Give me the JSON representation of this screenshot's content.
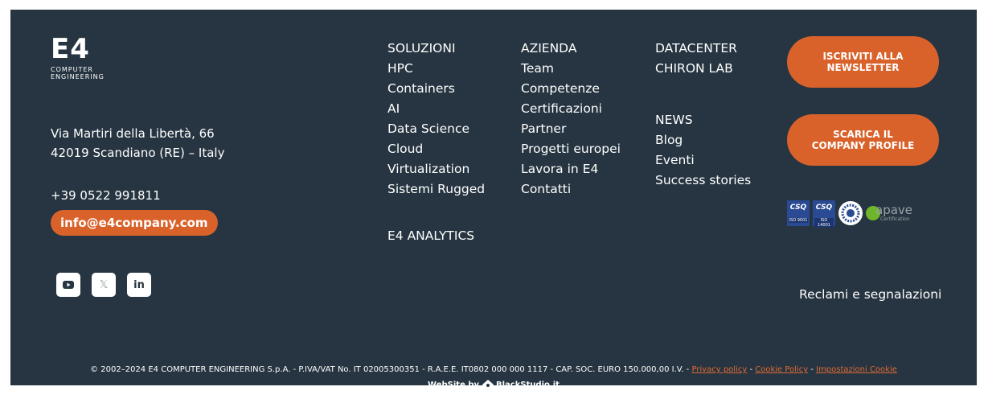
{
  "logo": {
    "main": "E4",
    "line1": "COMPUTER",
    "line2": "ENGINEERING"
  },
  "contact": {
    "address_line1": "Via Martiri della Libertà, 66",
    "address_line2": "42019 Scandiano (RE) – Italy",
    "phone": "+39 0522 991811",
    "email": "info@e4company.com"
  },
  "social": [
    {
      "icon": "youtube-icon",
      "glyph": "▶"
    },
    {
      "icon": "x-icon",
      "glyph": "𝕏"
    },
    {
      "icon": "linkedin-icon",
      "glyph": "in"
    }
  ],
  "col_soluzioni": [
    "SOLUZIONI",
    "HPC",
    "Containers",
    "AI",
    "Data Science",
    "Cloud",
    "Virtualization",
    "Sistemi Rugged"
  ],
  "analytics": "E4 ANALYTICS",
  "col_azienda": [
    "AZIENDA",
    "Team",
    "Competenze",
    "Certificazioni",
    "Partner",
    "Progetti europei",
    "Lavora in E4",
    "Contatti"
  ],
  "col_datacenter": [
    "DATACENTER",
    "CHIRON LAB"
  ],
  "col_news": [
    "NEWS",
    "Blog",
    "Eventi",
    "Success stories"
  ],
  "cta": {
    "newsletter_l1": "ISCRIVITI ALLA",
    "newsletter_l2": "NEWSLETTER",
    "profile_l1": "SCARICA IL",
    "profile_l2": "COMPANY PROFILE"
  },
  "certs": {
    "csq1": "CSQ",
    "csq1_sub": "ISO 9001",
    "csq2": "CSQ",
    "csq2_sub": "ISO 14001",
    "apave": "apave",
    "apave_sub": "Certification"
  },
  "reclami": "Reclami e segnalazioni",
  "legal": {
    "text": "© 2002–2024 E4 COMPUTER ENGINEERING S.p.A. - P.IVA/VAT No. IT 02005300351 - R.A.E.E. IT0802 000 000 1117 - CAP. SOC. EURO 150.000,00 I.V. - ",
    "privacy": "Privacy policy",
    "sep": " - ",
    "cookie": "Cookie Policy",
    "impostazioni": "Impostazioni Cookie"
  },
  "credit": {
    "prefix": "WebSite by ",
    "brand": "BlackStudio.it"
  },
  "colors": {
    "background": "#263541",
    "accent": "#d9622b",
    "link": "#e06a32"
  }
}
